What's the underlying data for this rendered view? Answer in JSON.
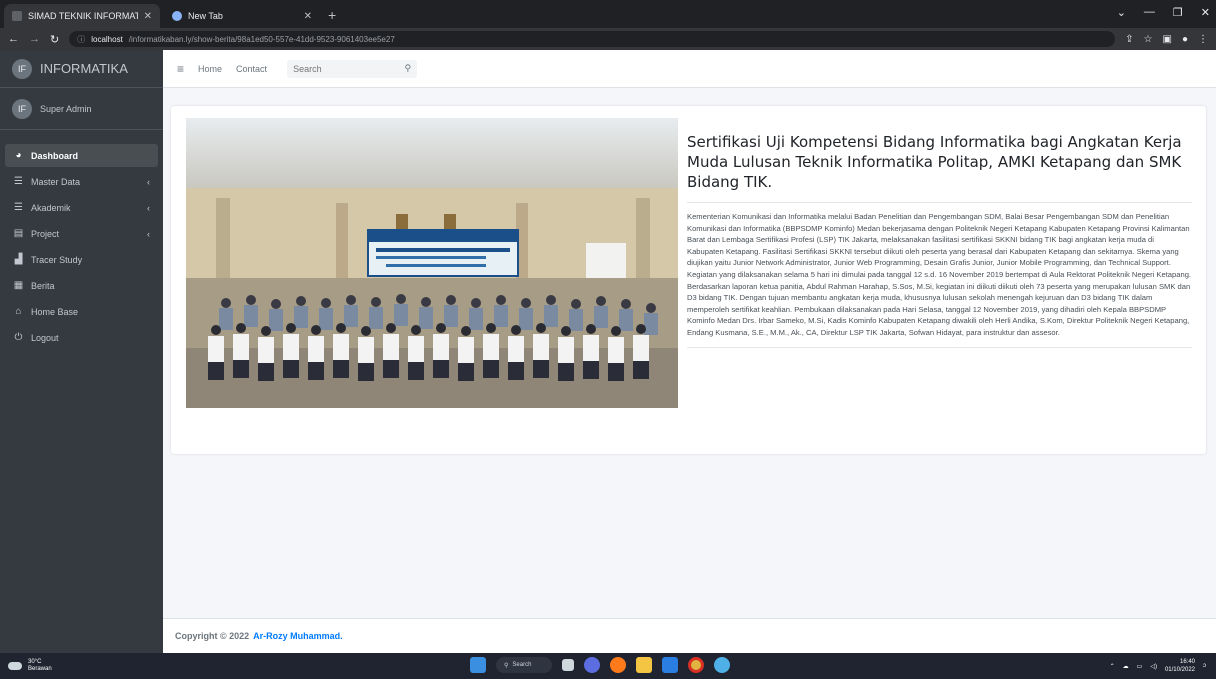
{
  "browser": {
    "tabs": [
      {
        "title": "SIMAD TEKNIK INFORMATIKA",
        "active": true,
        "favicon_color": "#5f6368"
      },
      {
        "title": "New Tab",
        "active": false,
        "favicon_color": "#8ab4f8"
      }
    ],
    "url_host": "localhost",
    "url_path": "/informatikaban.ly/show-berita/98a1ed50-557e-41dd-9523-9061403ee5e27",
    "window_controls": [
      "⌄",
      "—",
      "❐",
      "✕"
    ]
  },
  "sidebar": {
    "brand_logo": "IF",
    "brand_name": "INFORMATIKA",
    "user_avatar": "IF",
    "user_name": "Super Admin",
    "items": [
      {
        "label": "Dashboard",
        "icon": "palette-icon",
        "glyph": "◕",
        "active": true,
        "chevron": ""
      },
      {
        "label": "Master Data",
        "icon": "list-icon",
        "glyph": "☰",
        "active": false,
        "chevron": "‹"
      },
      {
        "label": "Akademik",
        "icon": "list-icon",
        "glyph": "☰",
        "active": false,
        "chevron": "‹"
      },
      {
        "label": "Project",
        "icon": "database-icon",
        "glyph": "▤",
        "active": false,
        "chevron": "‹"
      },
      {
        "label": "Tracer Study",
        "icon": "chart-icon",
        "glyph": "▟",
        "active": false,
        "chevron": ""
      },
      {
        "label": "Berita",
        "icon": "newspaper-icon",
        "glyph": "▦",
        "active": false,
        "chevron": ""
      },
      {
        "label": "Home Base",
        "icon": "home-icon",
        "glyph": "⌂",
        "active": false,
        "chevron": ""
      },
      {
        "label": "Logout",
        "icon": "power-icon",
        "glyph": "⏻",
        "active": false,
        "chevron": ""
      }
    ]
  },
  "topnav": {
    "menu_glyph": "≡",
    "home": "Home",
    "contact": "Contact",
    "search_placeholder": "Search",
    "search_glyph": "⚲"
  },
  "article": {
    "title": "Sertifikasi Uji Kompetensi Bidang Informatika bagi Angkatan Kerja Muda Lulusan Teknik Informatika Politap, AMKI Ketapang dan SMK Bidang TIK.",
    "body": "Kementerian Komunikasi dan Informatika melalui Badan Penelitian dan Pengembangan SDM, Balai Besar Pengembangan SDM dan Penelitian Komunikasi dan Informatika (BBPSDMP Kominfo) Medan bekerjasama dengan Politeknik Negeri Ketapang Kabupaten Ketapang Provinsi Kalimantan Barat dan Lembaga Sertifikasi Profesi (LSP) TIK Jakarta, melaksanakan fasilitasi sertifikasi SKKNI bidang TIK bagi angkatan kerja muda di Kabupaten Ketapang. Fasilitasi Sertifikasi SKKNI tersebut diikuti oleh peserta yang berasal dari Kabupaten Ketapang dan sekitarnya. Skema yang diujikan yaitu Junior Network Administrator, Junior Web Programming, Desain Grafis Junior, Junior Mobile Programming, dan Technical Support. Kegiatan yang dilaksanakan selama 5 hari ini dimulai pada tanggal 12 s.d. 16 November 2019 bertempat di Aula Rektorat Politeknik Negeri Ketapang. Berdasarkan laporan ketua panitia, Abdul Rahman Harahap, S.Sos, M.Si, kegiatan ini diikuti diikuti oleh 73 peserta yang merupakan lulusan SMK dan D3 bidang TIK. Dengan tujuan membantu angkatan kerja muda, khususnya lulusan sekolah menengah kejuruan dan D3 bidang TIK dalam memperoleh sertifikat keahlian. Pembukaan dilaksanakan pada Hari Selasa, tanggal 12 November 2019, yang dihadiri oleh Kepala BBPSDMP Kominfo Medan Drs. Irbar Sameko, M.Si, Kadis Kominfo Kabupaten Ketapang diwakili oleh Herli Andika, S.Kom, Direktur Politeknik Negeri Ketapang, Endang Kusmana, S.E., M.M., Ak., CA, Direktur LSP TIK Jakarta, Sofwan Hidayat, para instruktur dan assesor."
  },
  "footer": {
    "prefix": "Copyright © 2022",
    "author": "Ar-Rozy Muhammad."
  },
  "taskbar": {
    "temp": "30°C",
    "condition": "Berawan",
    "search_label": "Search",
    "time": "16:40",
    "date": "01/10/2022"
  },
  "colors": {
    "sidebar_bg": "#343a40",
    "main_bg": "#f4f6f9",
    "link_blue": "#007bff"
  }
}
